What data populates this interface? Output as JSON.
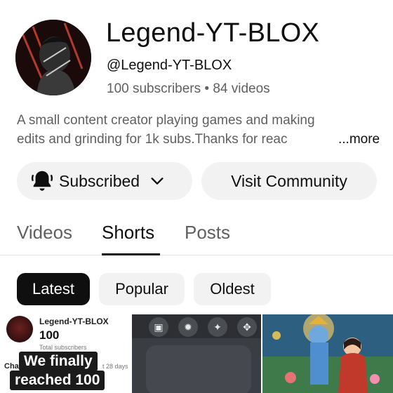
{
  "channel": {
    "name": "Legend-YT-BLOX",
    "handle": "@Legend-YT-BLOX",
    "stats": "100 subscribers • 84 videos",
    "description_line1": "A small content creator playing games and making",
    "description_line2": "edits and grinding for 1k subs.Thanks for reac",
    "more_label": "...more"
  },
  "actions": {
    "subscribed_label": "Subscribed",
    "community_label": "Visit Community"
  },
  "tabs": [
    {
      "label": "Videos",
      "active": false
    },
    {
      "label": "Shorts",
      "active": true
    },
    {
      "label": "Posts",
      "active": false
    }
  ],
  "filters": [
    {
      "label": "Latest",
      "selected": true
    },
    {
      "label": "Popular",
      "selected": false
    },
    {
      "label": "Oldest",
      "selected": false
    }
  ],
  "shorts": [
    {
      "channel_name": "Legend-YT-BLOX",
      "count": "100",
      "count_label": "Total subscribers",
      "left_fragment": "Cha",
      "right_fragment": "t 28 days",
      "caption_line1": "We finally",
      "caption_line2": "reached 100"
    },
    {
      "icons": [
        "image-icon",
        "gear-icon",
        "figure-icon",
        "spin-icon"
      ]
    },
    {
      "theme": "devotional-art"
    }
  ],
  "colors": {
    "primary_text": "#0f0f0f",
    "secondary_text": "#606060",
    "chip_bg": "#f2f2f2",
    "selected_chip_bg": "#0f0f0f"
  }
}
